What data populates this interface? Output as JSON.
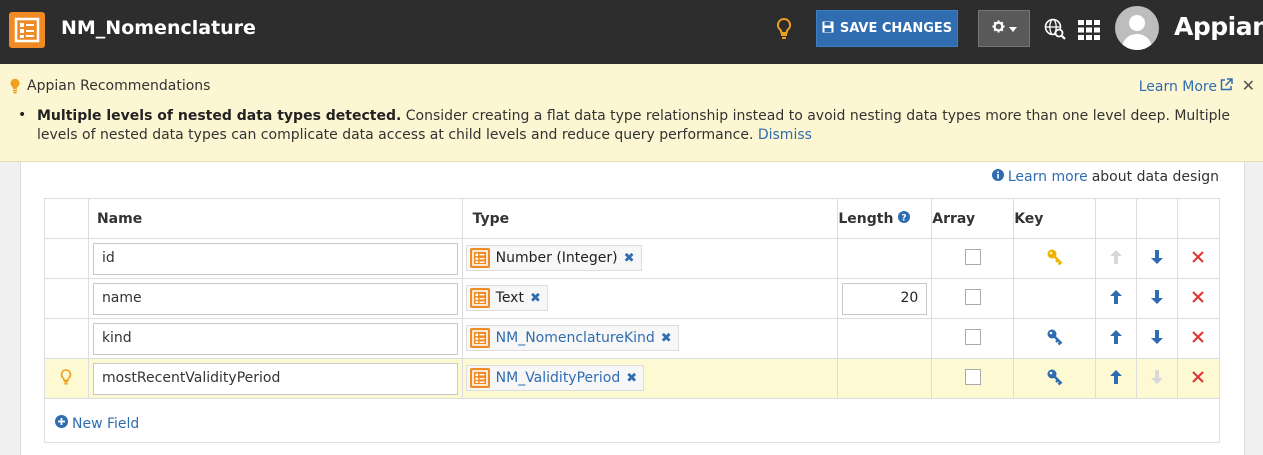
{
  "header": {
    "title": "NM_Nomenclature",
    "save_label": "SAVE CHANGES",
    "brand": "Appian",
    "colors": {
      "bar": "#2d2d2d",
      "accent": "#f08a24",
      "save": "#2f6db0"
    }
  },
  "banner": {
    "title": "Appian Recommendations",
    "learn_more": "Learn More",
    "msg_bold": "Multiple levels of nested data types detected.",
    "msg_text": " Consider creating a flat data type relationship instead to avoid nesting data types more than one level deep. Multiple levels of nested data types can complicate data access at child levels and reduce query performance. ",
    "dismiss": "Dismiss"
  },
  "about": {
    "link": "Learn more",
    "text": "about data design"
  },
  "table": {
    "headers": {
      "name": "Name",
      "type": "Type",
      "length": "Length",
      "array": "Array",
      "key": "Key"
    },
    "rows": [
      {
        "name": "id",
        "type": "Number (Integer)",
        "type_is_link": false,
        "length": "",
        "key": "primary",
        "up_enabled": false,
        "down_enabled": true,
        "highlight": false
      },
      {
        "name": "name",
        "type": "Text",
        "type_is_link": false,
        "length": "20",
        "key": "none",
        "up_enabled": true,
        "down_enabled": true,
        "highlight": false
      },
      {
        "name": "kind",
        "type": "NM_NomenclatureKind",
        "type_is_link": true,
        "length": "",
        "key": "foreign",
        "up_enabled": true,
        "down_enabled": true,
        "highlight": false
      },
      {
        "name": "mostRecentValidityPeriod",
        "type": "NM_ValidityPeriod",
        "type_is_link": true,
        "length": "",
        "key": "foreign",
        "up_enabled": true,
        "down_enabled": false,
        "highlight": true
      }
    ],
    "new_field": "New Field"
  }
}
